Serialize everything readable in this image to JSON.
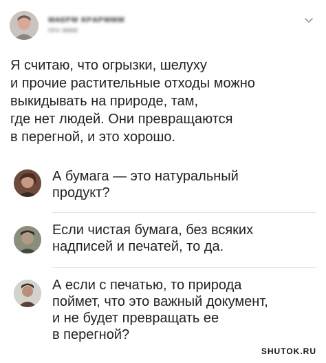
{
  "post": {
    "author_name": "ᴍᴀᴇᴩᴍ ᴋᴩᴀᴩᴍᴍᴍ",
    "author_handle": "ᴨᴩᴀ ᴍᴍᴍ",
    "text": "Я считаю, что огрызки, шелуху\nи прочие растительные отходы можно\nвыкидывать на природе, там,\nгде нет людей. Они превращаются\nв перегной, и это хорошо.",
    "menu_icon": "chevron-down-icon"
  },
  "comments": [
    {
      "text": "А бумага — это натуральный\nпродукт?"
    },
    {
      "text": "Если чистая бумага, без всяких\nнадписей и печатей, то да."
    },
    {
      "text": "А если с печатью, то природа\nпоймет, что это важный документ,\nи не будет превращать ее\nв перегной?"
    }
  ],
  "watermark": "SHUTOK.RU",
  "colors": {
    "text": "#222222",
    "divider": "#e6e6e6",
    "background": "#ffffff"
  }
}
